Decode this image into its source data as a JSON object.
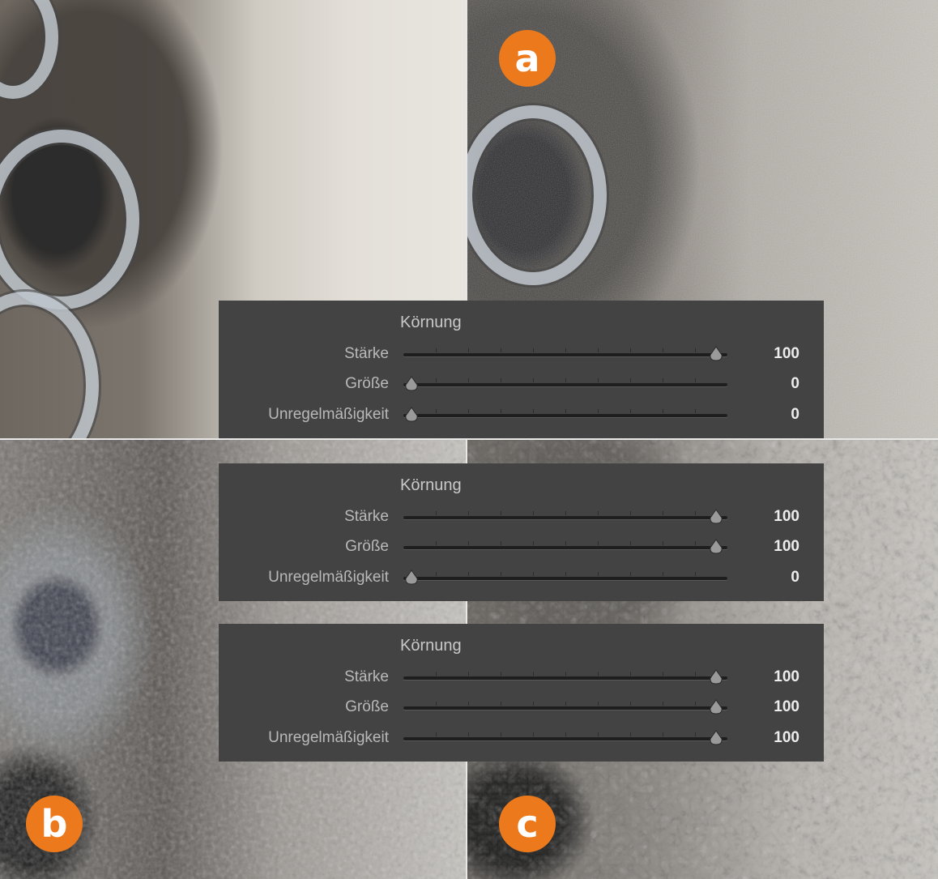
{
  "badges": {
    "a": "a",
    "b": "b",
    "c": "c"
  },
  "panels": [
    {
      "title": "Körnung",
      "sliders": [
        {
          "label": "Stärke",
          "value": "100",
          "level": 1.0
        },
        {
          "label": "Größe",
          "value": "0",
          "level": 0.0
        },
        {
          "label": "Unregelmäßigkeit",
          "value": "0",
          "level": 0.0
        }
      ]
    },
    {
      "title": "Körnung",
      "sliders": [
        {
          "label": "Stärke",
          "value": "100",
          "level": 1.0
        },
        {
          "label": "Größe",
          "value": "100",
          "level": 1.0
        },
        {
          "label": "Unregelmäßigkeit",
          "value": "0",
          "level": 0.0
        }
      ]
    },
    {
      "title": "Körnung",
      "sliders": [
        {
          "label": "Stärke",
          "value": "100",
          "level": 1.0
        },
        {
          "label": "Größe",
          "value": "100",
          "level": 1.0
        },
        {
          "label": "Unregelmäßigkeit",
          "value": "100",
          "level": 1.0
        }
      ]
    }
  ],
  "colors": {
    "badge": "#ec7a1c",
    "panel_bg": "#434343"
  }
}
